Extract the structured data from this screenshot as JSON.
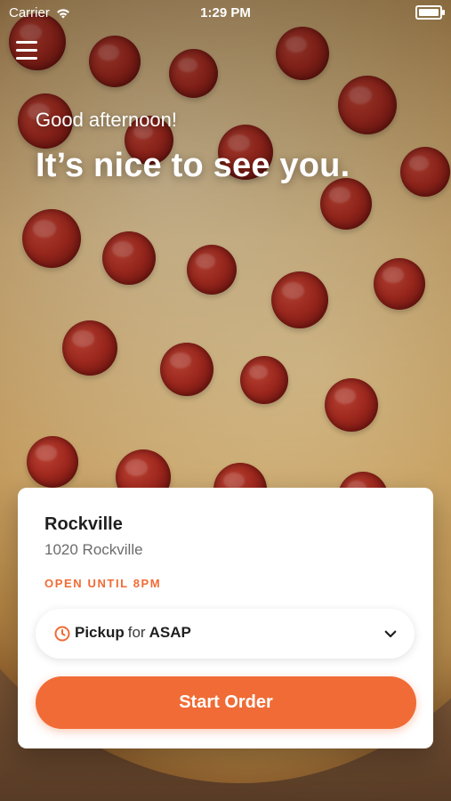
{
  "status_bar": {
    "carrier": "Carrier",
    "time": "1:29 PM"
  },
  "greeting": {
    "subtitle": "Good afternoon!",
    "headline": "It’s nice to see you."
  },
  "store_card": {
    "name": "Rockville",
    "address": "1020 Rockville",
    "hours": "OPEN UNTIL 8PM",
    "pickup_selector": {
      "mode": "Pickup",
      "connector": "for",
      "time": "ASAP"
    },
    "start_button_label": "Start Order"
  },
  "colors": {
    "accent": "#f06b35",
    "card_bg": "#ffffff",
    "text_primary": "#1f1f1f",
    "text_secondary": "#6b6b6b"
  },
  "icons": {
    "menu": "hamburger-menu-icon",
    "clock": "clock-icon",
    "chevron": "chevron-down-icon",
    "wifi": "wifi-icon",
    "battery": "battery-icon"
  }
}
